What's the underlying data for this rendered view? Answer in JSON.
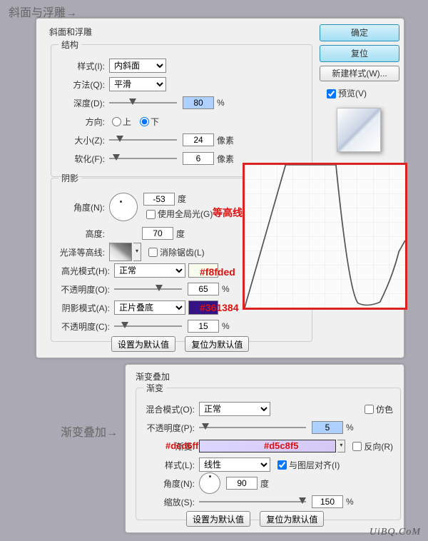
{
  "titles": {
    "bevel": "斜面与浮雕→",
    "grad": "渐变叠加→",
    "contour_arrow": "等高线→"
  },
  "dialog1": {
    "title": "斜面和浮雕",
    "struct": {
      "legend": "结构",
      "style_l": "样式(I):",
      "style_v": "内斜面",
      "tech_l": "方法(Q):",
      "tech_v": "平滑",
      "depth_l": "深度(D):",
      "depth_v": "80",
      "depth_u": "%",
      "dir_l": "方向:",
      "up": "上",
      "down": "下",
      "size_l": "大小(Z):",
      "size_v": "24",
      "size_u": "像素",
      "soft_l": "软化(F):",
      "soft_v": "6",
      "soft_u": "像素"
    },
    "shade": {
      "legend": "阴影",
      "angle_l": "角度(N):",
      "angle_v": "-53",
      "angle_u": "度",
      "global": "使用全局光(G)",
      "alt_l": "高度:",
      "alt_v": "70",
      "alt_u": "度",
      "gloss_l": "光泽等高线:",
      "anti": "消除锯齿(L)",
      "hmode_l": "高光模式(H):",
      "hmode_v": "正常",
      "hcolor": "#f8fded",
      "hop_l": "不透明度(O):",
      "hop_v": "65",
      "hop_u": "%",
      "smode_l": "阴影模式(A):",
      "smode_v": "正片叠底",
      "scolor": "#361384",
      "sop_l": "不透明度(C):",
      "sop_v": "15",
      "sop_u": "%"
    },
    "defaults": "设置为默认值",
    "reset": "复位为默认值"
  },
  "side": {
    "ok": "确定",
    "cancel": "复位",
    "new": "新建样式(W)...",
    "preview": "预览(V)"
  },
  "dialog2": {
    "title": "渐变叠加",
    "legend": "渐变",
    "blend_l": "混合模式(O):",
    "blend_v": "正常",
    "dither": "仿色",
    "op_l": "不透明度(P):",
    "op_v": "5",
    "op_u": "%",
    "grad_l": "渐变:",
    "reverse": "反向(R)",
    "c1": "#dcd6ff",
    "c2": "#d5c8f5",
    "style_l": "样式(L):",
    "style_v": "线性",
    "align": "与图层对齐(I)",
    "angle_l": "角度(N):",
    "angle_v": "90",
    "angle_u": "度",
    "scale_l": "缩放(S):",
    "scale_v": "150",
    "scale_u": "%",
    "defaults": "设置为默认值",
    "reset": "复位为默认值"
  },
  "watermark": "UiBQ.CoM",
  "chart_data": {
    "type": "line",
    "title": "等高线",
    "xlim": [
      0,
      255
    ],
    "ylim": [
      0,
      255
    ],
    "x": [
      0,
      65,
      90,
      145,
      165,
      195,
      215,
      245,
      255
    ],
    "y": [
      0,
      255,
      255,
      255,
      30,
      8,
      10,
      100,
      120
    ]
  }
}
